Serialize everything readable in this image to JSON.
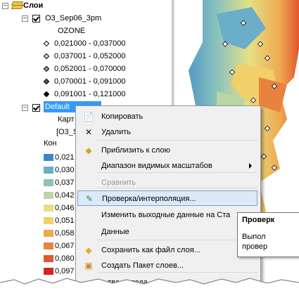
{
  "toc": {
    "root_label": "Слои",
    "layer1": {
      "name": "O3_Sep06_3pm",
      "field": "OZONE",
      "classes": [
        "0,021000 - 0,037000",
        "0,037001 - 0,052000",
        "0,052001 - 0,070000",
        "0,070001 - 0,091000",
        "0,091001 - 0,121000"
      ]
    },
    "layer2": {
      "name": "Default",
      "info_rows": [
        "Карт",
        "[O3_S",
        "Кон"
      ],
      "classes": [
        "0,021",
        "0,030",
        "0,037",
        "0,042",
        "0,046",
        "0,051",
        "0,058",
        "0,067",
        "0,080",
        "0,097"
      ],
      "class_colors": [
        "#3a86c6",
        "#6aaec9",
        "#8cc3bc",
        "#b9d6a5",
        "#e6e184",
        "#f1d06a",
        "#efa84f",
        "#e9823e",
        "#e2552f",
        "#d7251f"
      ]
    }
  },
  "context_menu": {
    "items": [
      {
        "label": "Копировать",
        "icon": "copy-icon"
      },
      {
        "label": "Удалить",
        "icon": "delete-icon"
      },
      {
        "label": "Приблизить к слою",
        "icon": "zoom-to-layer-icon"
      },
      {
        "label": "Диапазон видимых масштабов",
        "icon": "",
        "submenu": true
      },
      {
        "label": "Сравнить",
        "icon": "",
        "disabled": true
      },
      {
        "label": "Проверка/интерполяция...",
        "icon": "validation-icon",
        "highlighted": true
      },
      {
        "label": "Изменить выходные данные на Ста",
        "icon": ""
      },
      {
        "label": "Данные",
        "icon": ""
      },
      {
        "label": "Сохранить как файл слоя...",
        "icon": "save-layer-icon"
      },
      {
        "label": "Создать Пакет слоев...",
        "icon": "layer-package-icon"
      },
      {
        "label": "...тва метода...",
        "icon": ""
      }
    ]
  },
  "tooltip": {
    "title": "Проверк",
    "line1": "Выпол",
    "line2": "провер"
  },
  "colors": {
    "highlight": "#dbe9f8",
    "menu_bg": "#f0f0f0"
  }
}
